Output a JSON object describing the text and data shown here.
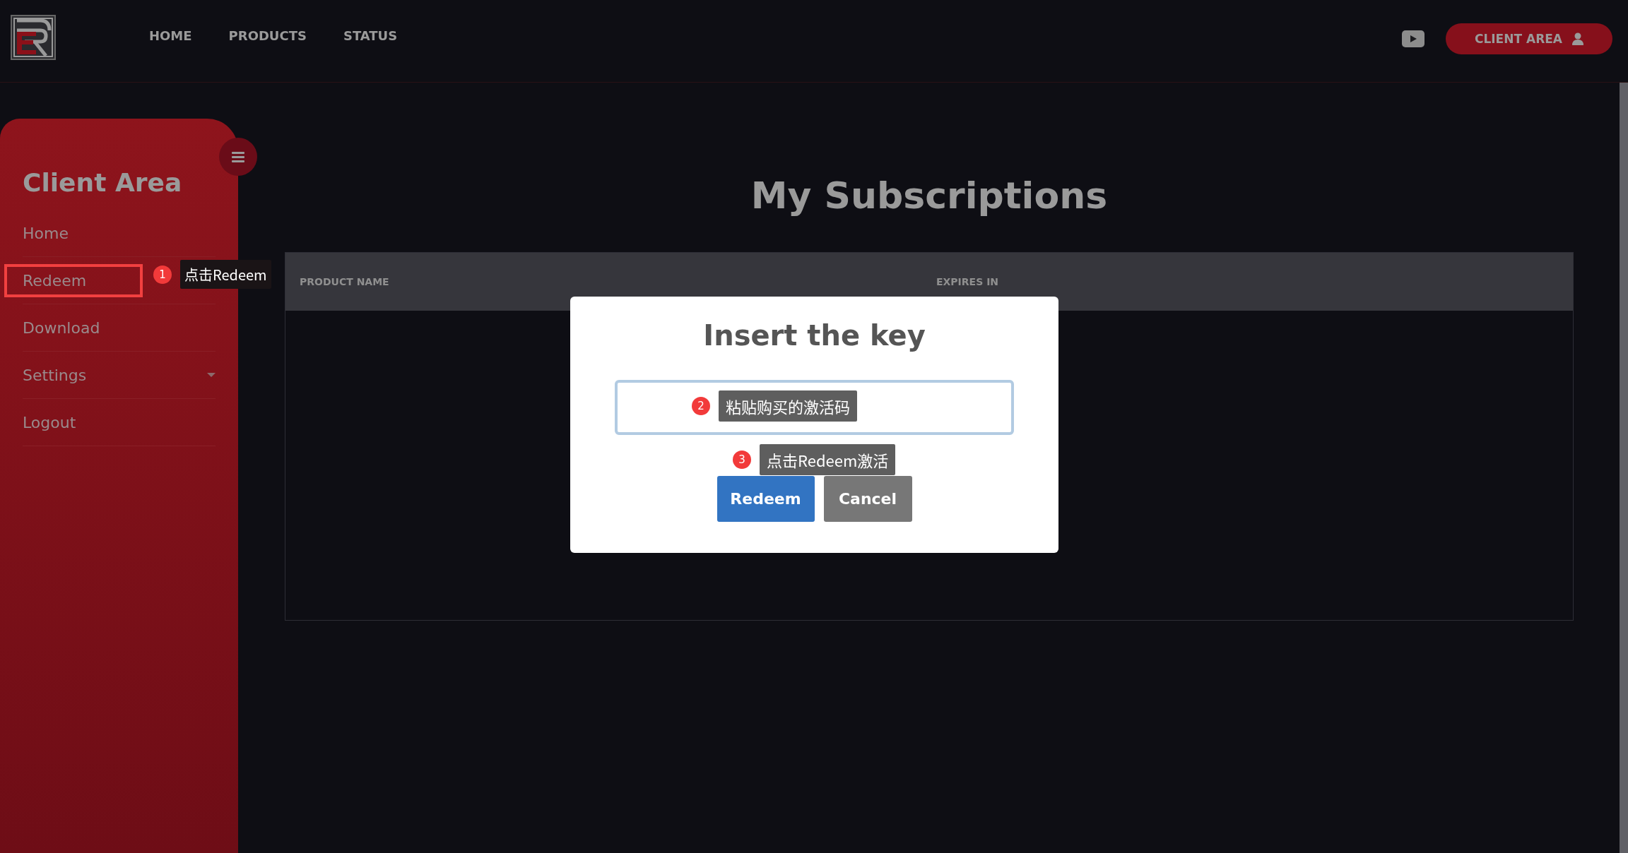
{
  "nav": {
    "links": [
      {
        "label": "HOME"
      },
      {
        "label": "PRODUCTS"
      },
      {
        "label": "STATUS"
      }
    ],
    "client_button": {
      "label": "CLIENT AREA"
    }
  },
  "sidebar": {
    "title": "Client Area",
    "items": [
      {
        "label": "Home",
        "highlighted": false,
        "has_submenu": false
      },
      {
        "label": "Redeem",
        "highlighted": true,
        "has_submenu": false
      },
      {
        "label": "Download",
        "highlighted": false,
        "has_submenu": false
      },
      {
        "label": "Settings",
        "highlighted": false,
        "has_submenu": true
      },
      {
        "label": "Logout",
        "highlighted": false,
        "has_submenu": false
      }
    ]
  },
  "page_title": "My Subscriptions",
  "table": {
    "columns": [
      "PRODUCT NAME",
      "EXPIRES IN"
    ]
  },
  "modal": {
    "title": "Insert the key",
    "buttons": [
      {
        "label": "Redeem",
        "kind": "primary"
      },
      {
        "label": "Cancel",
        "kind": "secondary"
      }
    ]
  },
  "annotations": [
    {
      "number": "1",
      "text": "点击Redeem",
      "kind": "sidebar"
    },
    {
      "number": "2",
      "text": "粘贴购买的激活码",
      "kind": "field"
    },
    {
      "number": "3",
      "text": "点击Redeem激活",
      "kind": "buttons"
    }
  ]
}
